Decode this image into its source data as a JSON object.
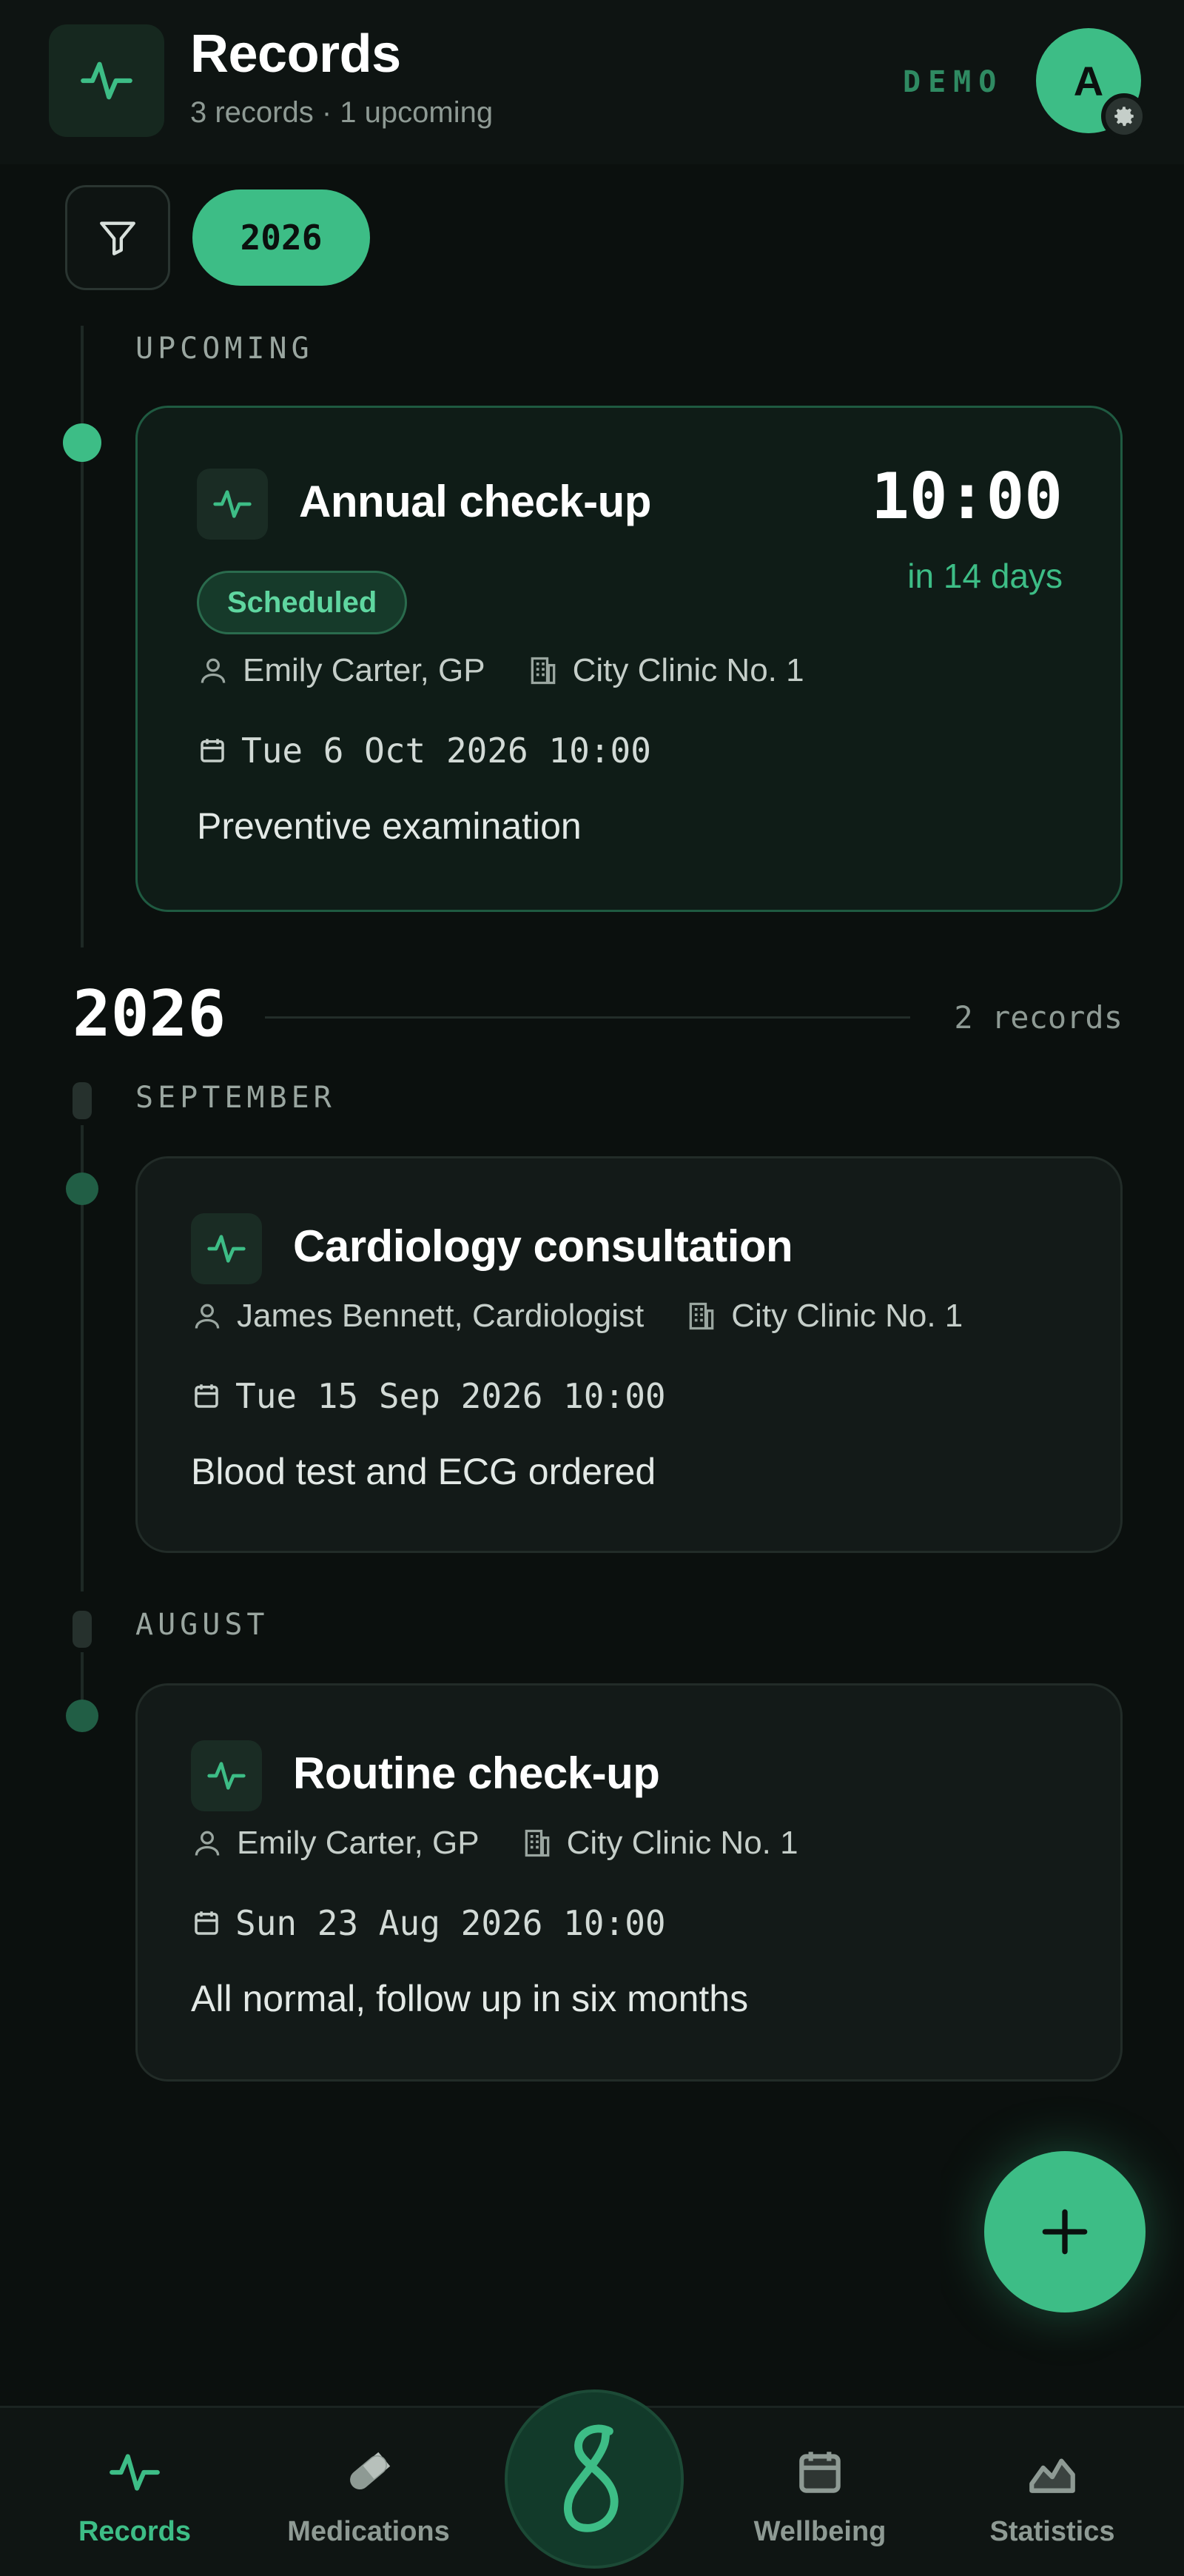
{
  "header": {
    "title": "Records",
    "subtitle": "3 records · 1 upcoming",
    "demo_label": "DEMO",
    "avatar_initial": "A"
  },
  "filters": {
    "year_chip": "2026"
  },
  "upcoming": {
    "section_label": "UPCOMING",
    "card": {
      "title": "Annual check-up",
      "time": "10:00",
      "relative": "in 14 days",
      "status": "Scheduled",
      "doctor": "Emily Carter, GP",
      "clinic": "City Clinic No. 1",
      "date": "Tue 6 Oct 2026 10:00",
      "note": "Preventive examination"
    }
  },
  "year_group": {
    "year": "2026",
    "count": "2 records",
    "months": [
      {
        "label": "SEPTEMBER",
        "card": {
          "title": "Cardiology consultation",
          "doctor": "James Bennett, Cardiologist",
          "clinic": "City Clinic No. 1",
          "date": "Tue 15 Sep 2026 10:00",
          "note": "Blood test and ECG ordered"
        }
      },
      {
        "label": "AUGUST",
        "card": {
          "title": "Routine check-up",
          "doctor": "Emily Carter, GP",
          "clinic": "City Clinic No. 1",
          "date": "Sun 23 Aug 2026 10:00",
          "note": "All normal, follow up in six months"
        }
      }
    ]
  },
  "nav": {
    "items": [
      {
        "label": "Records",
        "icon": "pulse-icon",
        "active": true
      },
      {
        "label": "Medications",
        "icon": "pill-icon",
        "active": false
      },
      {
        "label": "Wellbeing",
        "icon": "calendar-icon",
        "active": false
      },
      {
        "label": "Statistics",
        "icon": "chart-icon",
        "active": false
      }
    ]
  },
  "colors": {
    "accent": "#3dbd86",
    "background": "#0b100e",
    "card": "#131a18"
  }
}
